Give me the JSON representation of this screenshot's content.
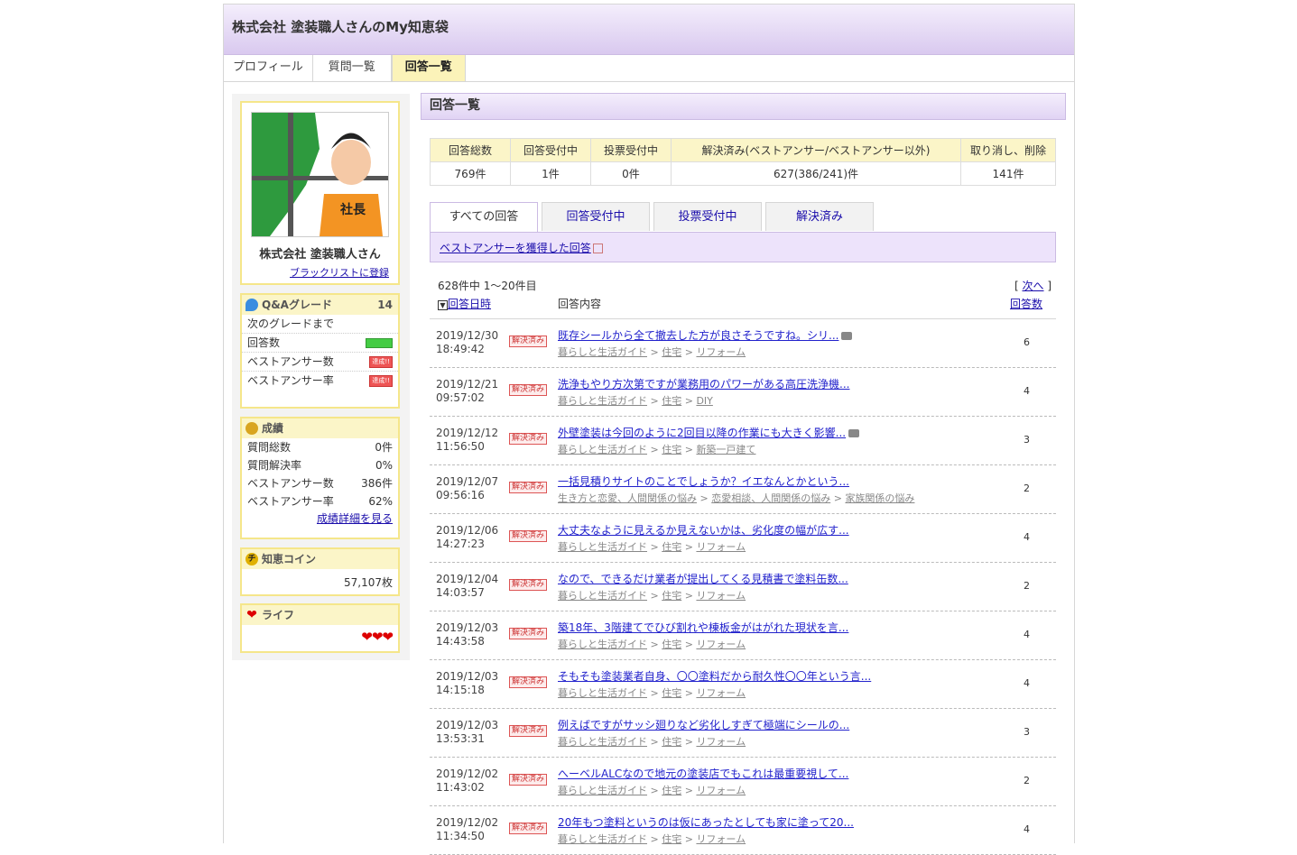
{
  "header": {
    "title": "株式会社 塗装職人さんのMy知恵袋"
  },
  "nav": [
    "プロフィール",
    "質問一覧",
    "回答一覧"
  ],
  "profile": {
    "name": "株式会社 塗装職人さん",
    "blacklist_link": "ブラックリストに登録",
    "avatar_text": "社長"
  },
  "grade": {
    "title": "Q&Aグレード",
    "level": "14",
    "next": "次のグレードまで",
    "answers": "回答数",
    "best_count": "ベストアンサー数",
    "best_rate": "ベストアンサー率",
    "achieved": "達成!!"
  },
  "score": {
    "title": "成績",
    "rows": [
      {
        "label": "質問総数",
        "value": "0件"
      },
      {
        "label": "質問解決率",
        "value": "0%"
      },
      {
        "label": "ベストアンサー数",
        "value": "386件"
      },
      {
        "label": "ベストアンサー率",
        "value": "62%"
      }
    ],
    "detail_link": "成績詳細を見る"
  },
  "coin": {
    "title": "知恵コイン",
    "value": "57,107枚"
  },
  "life": {
    "title": "ライフ",
    "hearts": 3
  },
  "main": {
    "title": "回答一覧"
  },
  "stats": {
    "headers": [
      "回答総数",
      "回答受付中",
      "投票受付中",
      "解決済み(ベストアンサー/ベストアンサー以外)",
      "取り消し、削除"
    ],
    "values": [
      "769件",
      "1件",
      "0件",
      "627(386/241)件",
      "141件"
    ]
  },
  "tabs": [
    "すべての回答",
    "回答受付中",
    "投票受付中",
    "解決済み"
  ],
  "best_link": "ベストアンサーを獲得した回答",
  "list_meta": {
    "count": "628件中 1〜20件目",
    "next": "次へ",
    "col_date": "回答日時",
    "col_content": "回答内容",
    "col_answers": "回答数"
  },
  "status_label": "解決済み",
  "items": [
    {
      "date": "2019/12/30",
      "time": "18:49:42",
      "q": "既存シールから全て撤去した方が良さそうですね。シリ...",
      "cam": true,
      "cat": [
        "暮らしと生活ガイド",
        "住宅",
        "リフォーム"
      ],
      "n": "6"
    },
    {
      "date": "2019/12/21",
      "time": "09:57:02",
      "q": "洗浄もやり方次第ですが業務用のパワーがある高圧洗浄機...",
      "cam": false,
      "cat": [
        "暮らしと生活ガイド",
        "住宅",
        "DIY"
      ],
      "n": "4"
    },
    {
      "date": "2019/12/12",
      "time": "11:56:50",
      "q": "外壁塗装は今回のように2回目以降の作業にも大きく影響...",
      "cam": true,
      "cat": [
        "暮らしと生活ガイド",
        "住宅",
        "新築一戸建て"
      ],
      "n": "3"
    },
    {
      "date": "2019/12/07",
      "time": "09:56:16",
      "q": "一括見積りサイトのことでしょうか？イエなんとかという...",
      "cam": false,
      "cat": [
        "生き方と恋愛、人間関係の悩み",
        "恋愛相談、人間関係の悩み",
        "家族関係の悩み"
      ],
      "n": "2"
    },
    {
      "date": "2019/12/06",
      "time": "14:27:23",
      "q": "大丈夫なように見えるか見えないかは、劣化度の幅が広す...",
      "cam": false,
      "cat": [
        "暮らしと生活ガイド",
        "住宅",
        "リフォーム"
      ],
      "n": "4"
    },
    {
      "date": "2019/12/04",
      "time": "14:03:57",
      "q": "なので、できるだけ業者が提出してくる見積書で塗料缶数...",
      "cam": false,
      "cat": [
        "暮らしと生活ガイド",
        "住宅",
        "リフォーム"
      ],
      "n": "2"
    },
    {
      "date": "2019/12/03",
      "time": "14:43:58",
      "q": "築18年、3階建てでひび割れや棟板金がはがれた現状を言...",
      "cam": false,
      "cat": [
        "暮らしと生活ガイド",
        "住宅",
        "リフォーム"
      ],
      "n": "4"
    },
    {
      "date": "2019/12/03",
      "time": "14:15:18",
      "q": "そもそも塗装業者自身、〇〇塗料だから耐久性〇〇年という言...",
      "cam": false,
      "cat": [
        "暮らしと生活ガイド",
        "住宅",
        "リフォーム"
      ],
      "n": "4"
    },
    {
      "date": "2019/12/03",
      "time": "13:53:31",
      "q": "例えばですがサッシ廻りなど劣化しすぎて極端にシールの...",
      "cam": false,
      "cat": [
        "暮らしと生活ガイド",
        "住宅",
        "リフォーム"
      ],
      "n": "3"
    },
    {
      "date": "2019/12/02",
      "time": "11:43:02",
      "q": "へーベルALCなので地元の塗装店でもこれは最重要視して...",
      "cam": false,
      "cat": [
        "暮らしと生活ガイド",
        "住宅",
        "リフォーム"
      ],
      "n": "2"
    },
    {
      "date": "2019/12/02",
      "time": "11:34:50",
      "q": "20年もつ塗料というのは仮にあったとしても家に塗って20...",
      "cam": false,
      "cat": [
        "暮らしと生活ガイド",
        "住宅",
        "リフォーム"
      ],
      "n": "4"
    }
  ]
}
